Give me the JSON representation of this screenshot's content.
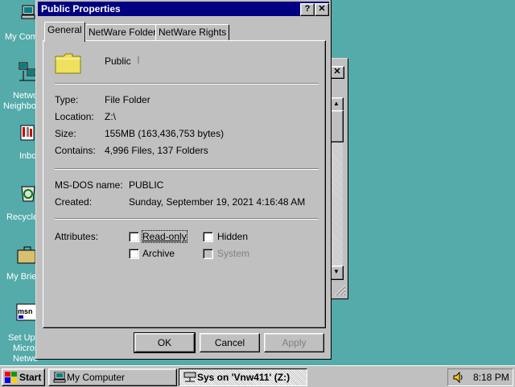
{
  "desktop": {
    "icons": [
      {
        "label": "My Comp",
        "icon": "my-computer-icon"
      },
      {
        "label": "Netwo",
        "label2": "Neighbo",
        "icon": "network-neighborhood-icon"
      },
      {
        "label": "Inbo",
        "icon": "inbox-icon"
      },
      {
        "label": "Recycle",
        "icon": "recycle-bin-icon"
      },
      {
        "label": "My Brief",
        "icon": "briefcase-icon"
      },
      {
        "label": "Set Up",
        "label2": "Micros",
        "label3": "Netwo",
        "icon": "msn-icon"
      }
    ]
  },
  "dialog": {
    "title": "Public Properties",
    "help_btn": "?",
    "close_btn": "✕",
    "tabs": [
      "General",
      "NetWare Folder",
      "NetWare Rights"
    ],
    "folder_name": "Public",
    "info": {
      "type_label": "Type:",
      "type_value": "File Folder",
      "location_label": "Location:",
      "location_value": "Z:\\",
      "size_label": "Size:",
      "size_value": "155MB (163,436,753 bytes)",
      "contains_label": "Contains:",
      "contains_value": "4,996 Files, 137 Folders",
      "msdos_label": "MS-DOS name:",
      "msdos_value": "PUBLIC",
      "created_label": "Created:",
      "created_value": "Sunday, September 19, 2021 4:16:48 AM"
    },
    "attributes": {
      "label": "Attributes:",
      "read_only": "Read-only",
      "hidden": "Hidden",
      "archive": "Archive",
      "system": "System"
    },
    "buttons": {
      "ok": "OK",
      "cancel": "Cancel",
      "apply": "Apply"
    }
  },
  "taskbar": {
    "start": "Start",
    "items": [
      "My Computer",
      "Sys on 'Vnw411' (Z:)"
    ],
    "time": "8:18 PM"
  },
  "colors": {
    "desktop": "#55aaaa",
    "titlebar": "#000080",
    "face": "#c0c0c0"
  }
}
